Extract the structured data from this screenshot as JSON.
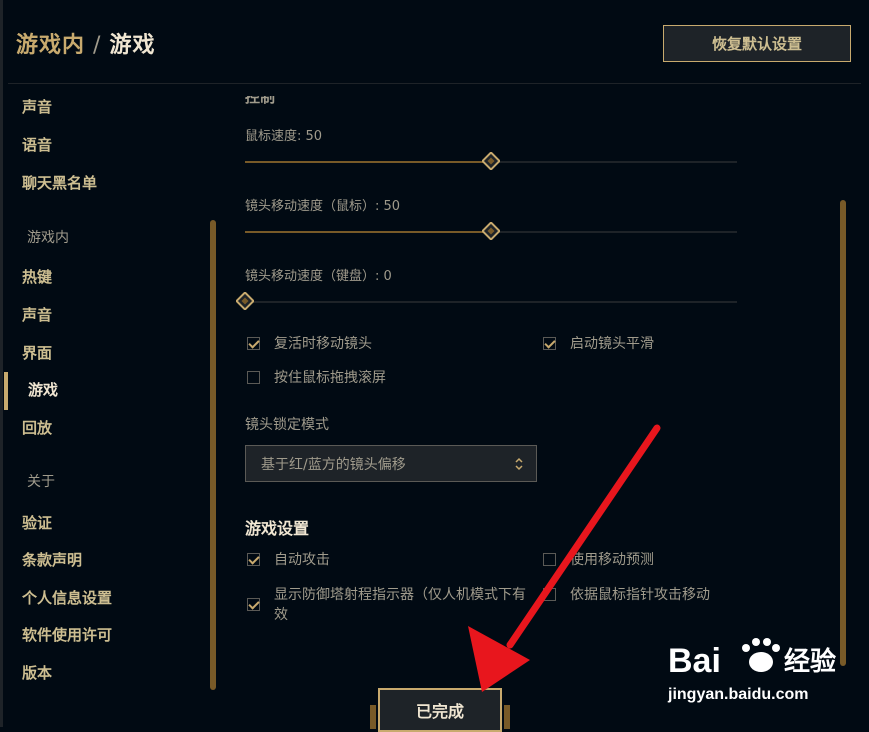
{
  "header": {
    "breadcrumb_parent": "游戏内",
    "separator": "/",
    "breadcrumb_current": "游戏",
    "restore_button": "恢复默认设置"
  },
  "sidebar": {
    "items": [
      {
        "label": "声音",
        "type": "item"
      },
      {
        "label": "语音",
        "type": "item"
      },
      {
        "label": "聊天黑名单",
        "type": "item"
      },
      {
        "label": "游戏内",
        "type": "section"
      },
      {
        "label": "热键",
        "type": "item"
      },
      {
        "label": "声音",
        "type": "item"
      },
      {
        "label": "界面",
        "type": "item"
      },
      {
        "label": "游戏",
        "type": "item",
        "active": true
      },
      {
        "label": "回放",
        "type": "item"
      },
      {
        "label": "关于",
        "type": "section"
      },
      {
        "label": "验证",
        "type": "item"
      },
      {
        "label": "条款声明",
        "type": "item"
      },
      {
        "label": "个人信息设置",
        "type": "item"
      },
      {
        "label": "软件使用许可",
        "type": "item"
      },
      {
        "label": "版本",
        "type": "item"
      }
    ]
  },
  "controls": {
    "partial_title": "控制",
    "sliders": [
      {
        "label": "鼠标速度: 50",
        "value": 50
      },
      {
        "label": "镜头移动速度（鼠标）: 50",
        "value": 50
      },
      {
        "label": "镜头移动速度（键盘）: 0",
        "value": 0
      }
    ],
    "checkboxes": [
      {
        "label": "复活时移动镜头",
        "checked": true
      },
      {
        "label": "启动镜头平滑",
        "checked": true
      },
      {
        "label": "按住鼠标拖拽滚屏",
        "checked": false
      }
    ],
    "camera_lock_label": "镜头锁定模式",
    "camera_lock_value": "基于红/蓝方的镜头偏移"
  },
  "game_settings": {
    "title": "游戏设置",
    "checkboxes": [
      {
        "label": "自动攻击",
        "checked": true
      },
      {
        "label": "使用移动预测",
        "checked": false
      },
      {
        "label": "显示防御塔射程指示器（仅人机模式下有效",
        "checked": true
      },
      {
        "label": "依据鼠标指针攻击移动",
        "checked": false
      }
    ]
  },
  "footer": {
    "done_button": "已完成"
  },
  "watermark": {
    "text": "jingyan.baidu.com"
  },
  "colors": {
    "background": "#010a13",
    "gold": "#c8aa6e",
    "gold_dark": "#785a28",
    "text": "#a09b8c",
    "text_bright": "#f0e6d2",
    "arrow": "#e8161d"
  }
}
